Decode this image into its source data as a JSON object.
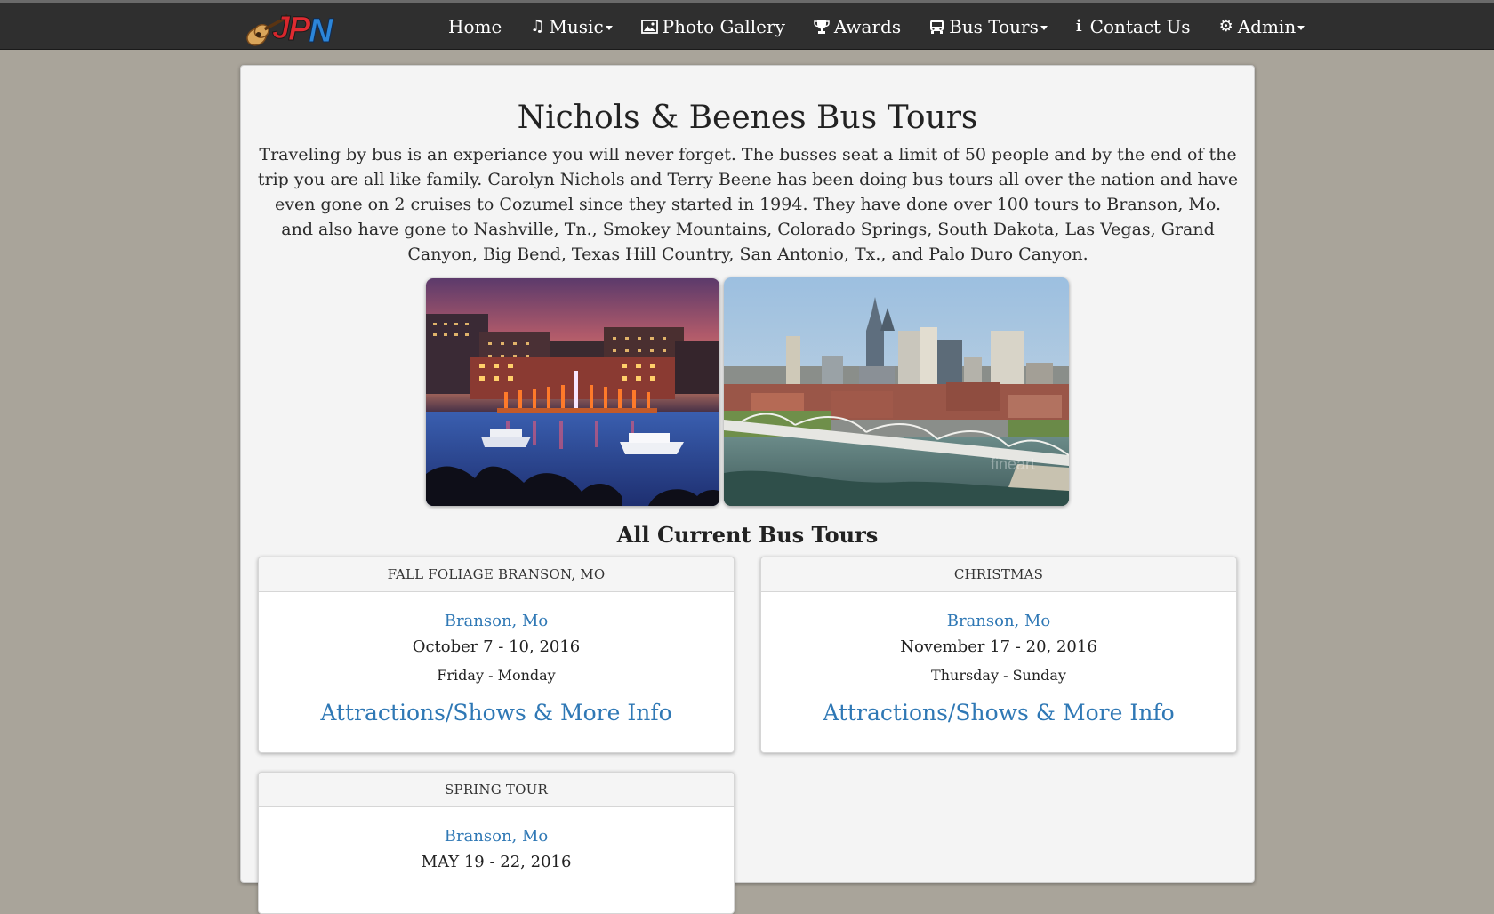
{
  "nav": {
    "logo_text": "JPN",
    "items": [
      {
        "label": "Home",
        "icon": "",
        "dropdown": false
      },
      {
        "label": "Music",
        "icon": "music-note-icon",
        "dropdown": true
      },
      {
        "label": "Photo Gallery",
        "icon": "picture-icon",
        "dropdown": false
      },
      {
        "label": "Awards",
        "icon": "trophy-icon",
        "dropdown": false
      },
      {
        "label": "Bus Tours",
        "icon": "bus-icon",
        "dropdown": true
      },
      {
        "label": "Contact Us",
        "icon": "info-icon",
        "dropdown": false
      },
      {
        "label": "Admin",
        "icon": "gear-icon",
        "dropdown": true
      }
    ]
  },
  "page": {
    "title": "Nichols & Beenes Bus Tours",
    "intro": "Traveling by bus is an experiance you will never forget. The busses seat a limit of 50 people and by the end of the trip you are all like family. Carolyn Nichols and Terry Beene has been doing bus tours all over the nation and have even gone on 2 cruises to Cozumel since they started in 1994. They have done over 100 tours to Branson, Mo. and also have gone to Nashville, Tn., Smokey Mountains, Colorado Springs, South Dakota, Las Vegas, Grand Canyon, Big Bend, Texas Hill Country, San Antonio, Tx., and Palo Duro Canyon.",
    "section_title": "All Current Bus Tours",
    "photo_watermark": "fineart"
  },
  "tours": [
    {
      "name": "FALL FOLIAGE BRANSON, MO",
      "location": "Branson, Mo",
      "dates": "October 7 - 10, 2016",
      "days": "Friday - Monday",
      "link": "Attractions/Shows & More Info"
    },
    {
      "name": "CHRISTMAS",
      "location": "Branson, Mo",
      "dates": "November 17 - 20, 2016",
      "days": "Thursday - Sunday",
      "link": "Attractions/Shows & More Info"
    },
    {
      "name": "SPRING TOUR",
      "location": "Branson, Mo",
      "dates": "MAY 19 - 22, 2016",
      "days": "",
      "link": ""
    }
  ],
  "colors": {
    "navbar": "#2f2f2f",
    "background": "#a9a49a",
    "panel": "#f4f4f4",
    "link": "#2f78b5"
  }
}
